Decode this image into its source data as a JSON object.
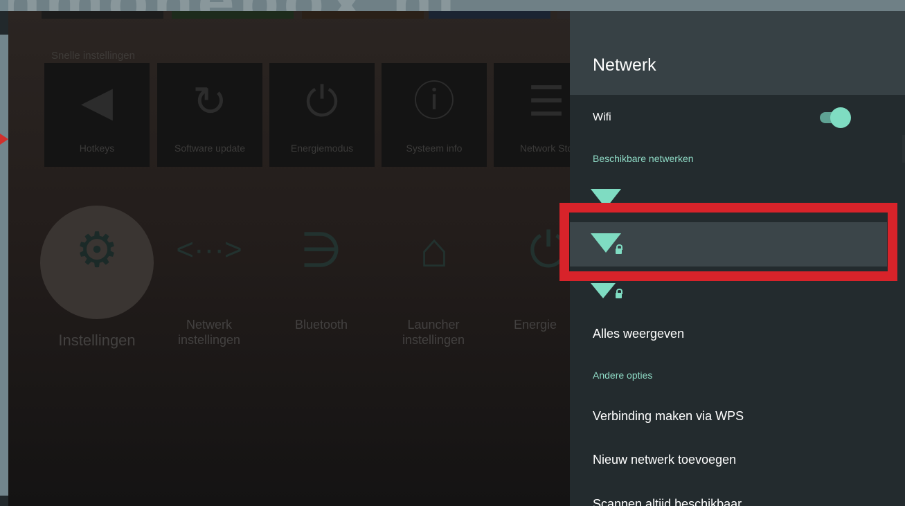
{
  "watermark": "nmonebox.nl",
  "tv": {
    "section_title": "Snelle instellingen",
    "tiles": [
      {
        "label": "Hotkeys",
        "icon": "hotkeys-icon"
      },
      {
        "label": "Software update",
        "icon": "software-update-icon"
      },
      {
        "label": "Energiemodus",
        "icon": "energy-mode-icon"
      },
      {
        "label": "Systeem info",
        "icon": "info-icon"
      },
      {
        "label": "Network Sto",
        "icon": "network-storage-icon"
      }
    ],
    "main_items": [
      {
        "label": "Instellingen",
        "icon": "gear-icon"
      },
      {
        "label": "Netwerk instellingen",
        "icon": "network-code-icon"
      },
      {
        "label": "Bluetooth",
        "icon": "bluetooth-icon"
      },
      {
        "label": "Launcher instellingen",
        "icon": "home-gear-icon"
      },
      {
        "label": "Energie",
        "icon": "power-icon"
      }
    ]
  },
  "panel": {
    "title": "Netwerk",
    "wifi_label": "Wifi",
    "wifi_on": true,
    "available_header": "Beschikbare netwerken",
    "networks": [
      {
        "name": "",
        "locked": false
      },
      {
        "name": "",
        "locked": true
      },
      {
        "name": "",
        "locked": true
      }
    ],
    "show_all": "Alles weergeven",
    "other_header": "Andere opties",
    "wps": "Verbinding maken via WPS",
    "add_network": "Nieuw netwerk toevoegen",
    "scan_always": "Scannen altijd beschikbaar"
  },
  "colors": {
    "accent": "#7fdcc2",
    "highlight": "#d8232a",
    "panel_bg": "#232b2e",
    "header_bg": "#374145"
  }
}
